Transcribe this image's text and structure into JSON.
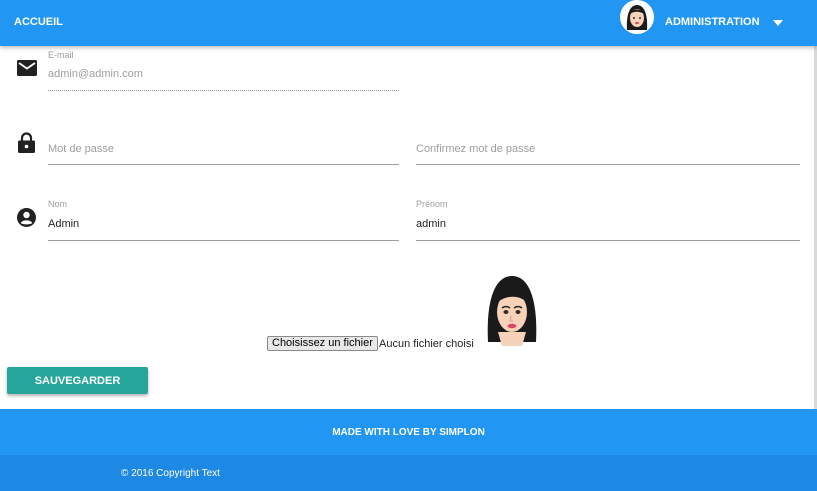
{
  "header": {
    "home_label": "ACCUEIL",
    "admin_label": "ADMINISTRATION"
  },
  "form": {
    "email": {
      "label": "E-mail",
      "placeholder": "admin@admin.com"
    },
    "password": {
      "placeholder": "Mot de passe"
    },
    "password_confirm": {
      "placeholder": "Confirmez mot de passe"
    },
    "last_name": {
      "label": "Nom",
      "value": "Admin"
    },
    "first_name": {
      "label": "Prénom",
      "value": "admin"
    },
    "file": {
      "button_label": "Choisissez un fichier",
      "status": "Aucun fichier choisi"
    },
    "save_label": "SAUVEGARDER"
  },
  "icons": {
    "email": "email-icon",
    "password": "lock-icon",
    "name": "account-circle-icon",
    "menu_caret": "caret-down-icon",
    "avatar": "avatar-icon"
  },
  "footer": {
    "made_with": "MADE WITH LOVE BY SIMPLON",
    "copyright": "© 2016 Copyright Text"
  },
  "colors": {
    "primary": "#2196f3",
    "primary_dark": "#1e88e5",
    "accent": "#26a69a"
  }
}
